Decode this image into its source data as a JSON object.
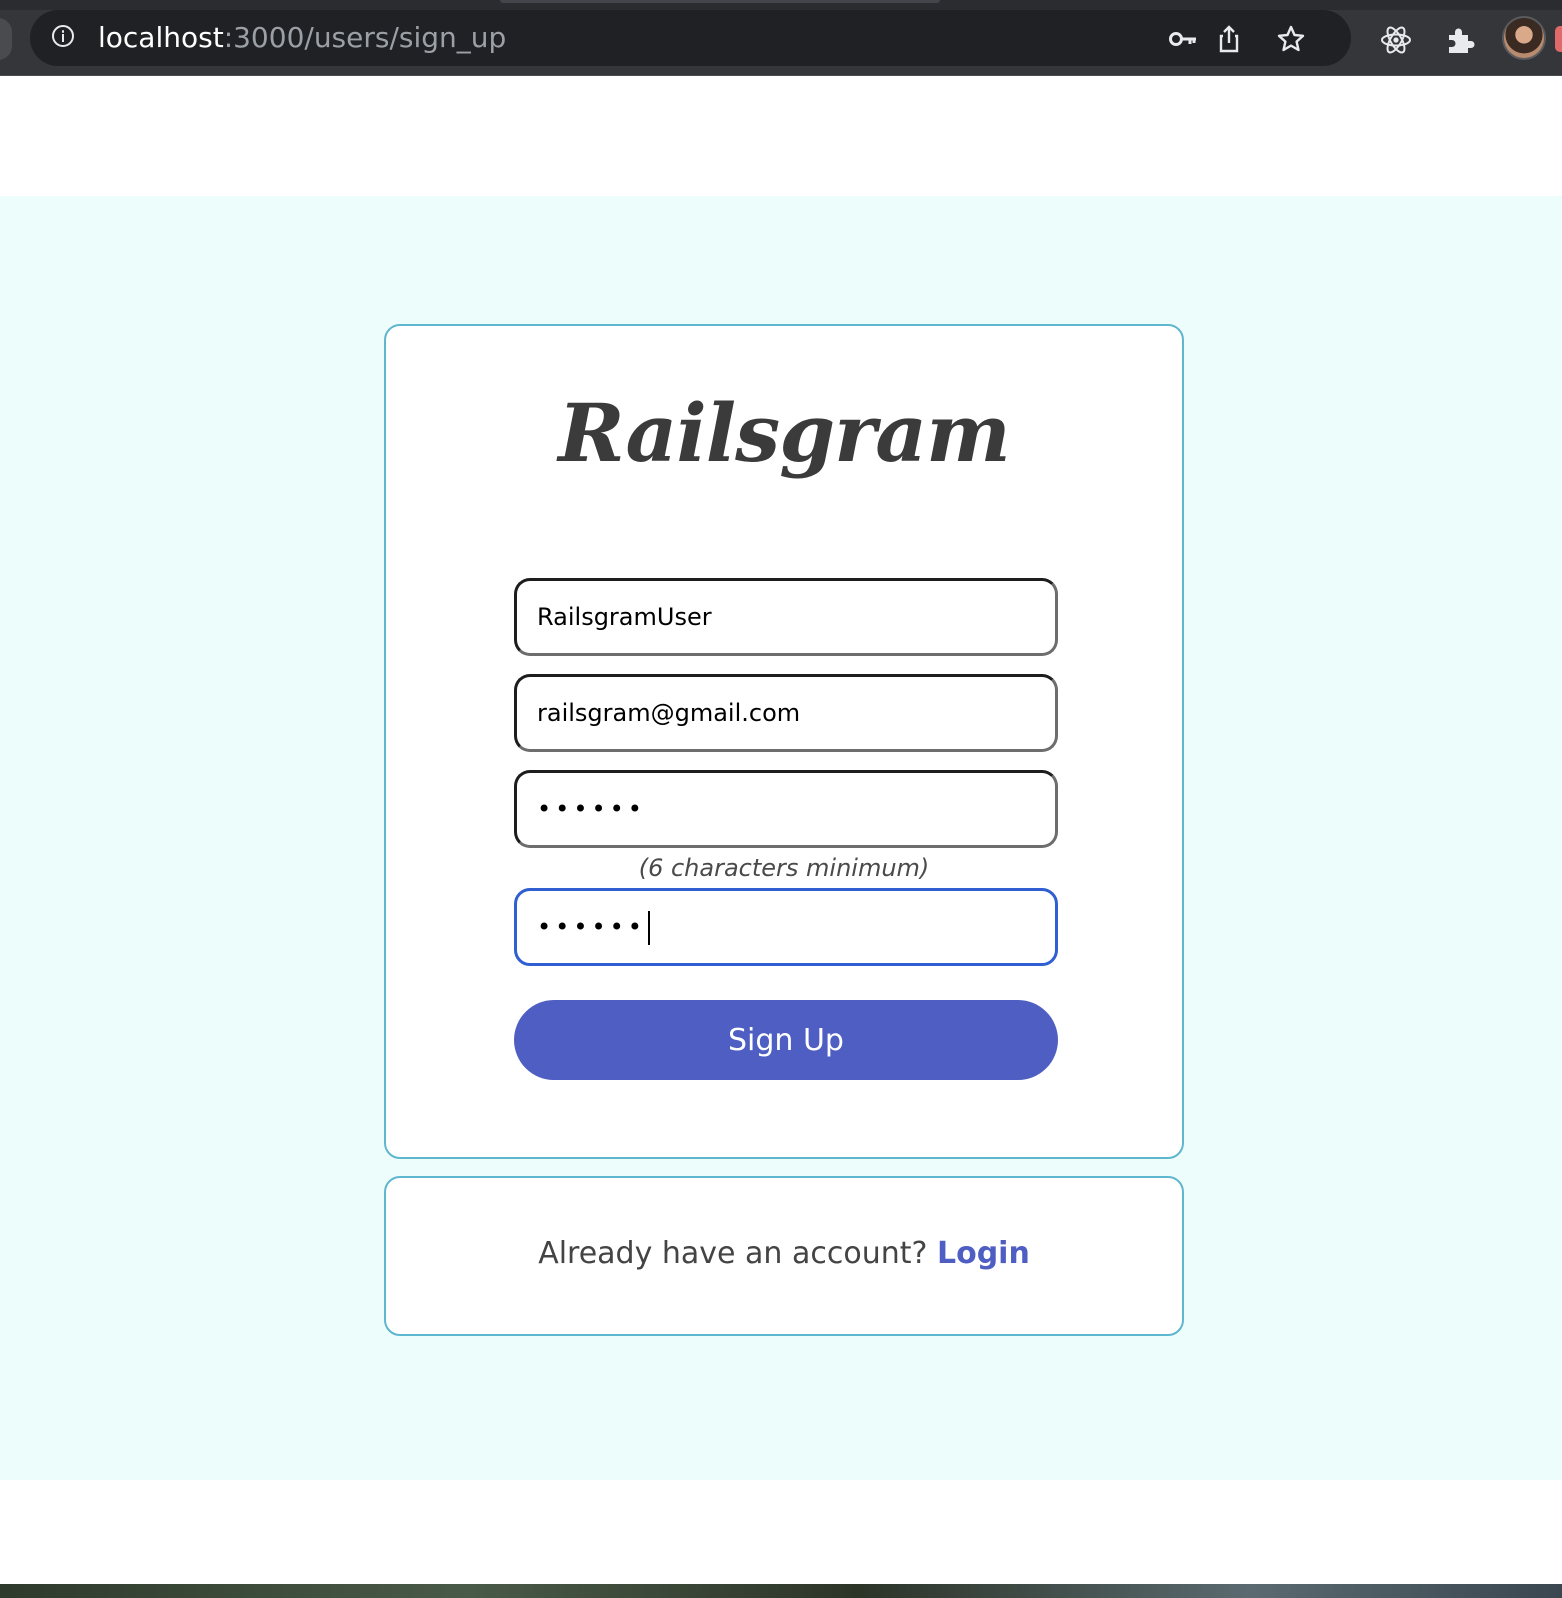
{
  "browser": {
    "url_host": "localhost",
    "url_path": ":3000/users/sign_up",
    "toolbar_icons": [
      "info-icon",
      "key-icon",
      "share-icon",
      "star-icon",
      "react-devtools-icon",
      "extensions-icon",
      "profile-avatar"
    ]
  },
  "page": {
    "logo": "Railsgram",
    "form": {
      "username_value": "RailsgramUser",
      "email_value": "railsgram@gmail.com",
      "password_value": "••••••",
      "password_hint": "(6 characters minimum)",
      "password_confirmation_value": "••••••",
      "submit_label": "Sign Up"
    },
    "login_prompt": {
      "text": "Already have an account?",
      "link_label": "Login"
    },
    "colors": {
      "accent": "#4e5ec2",
      "band_background": "#edfdfb",
      "card_border": "#5fb6cf",
      "focus_border": "#2f5fd0"
    }
  }
}
